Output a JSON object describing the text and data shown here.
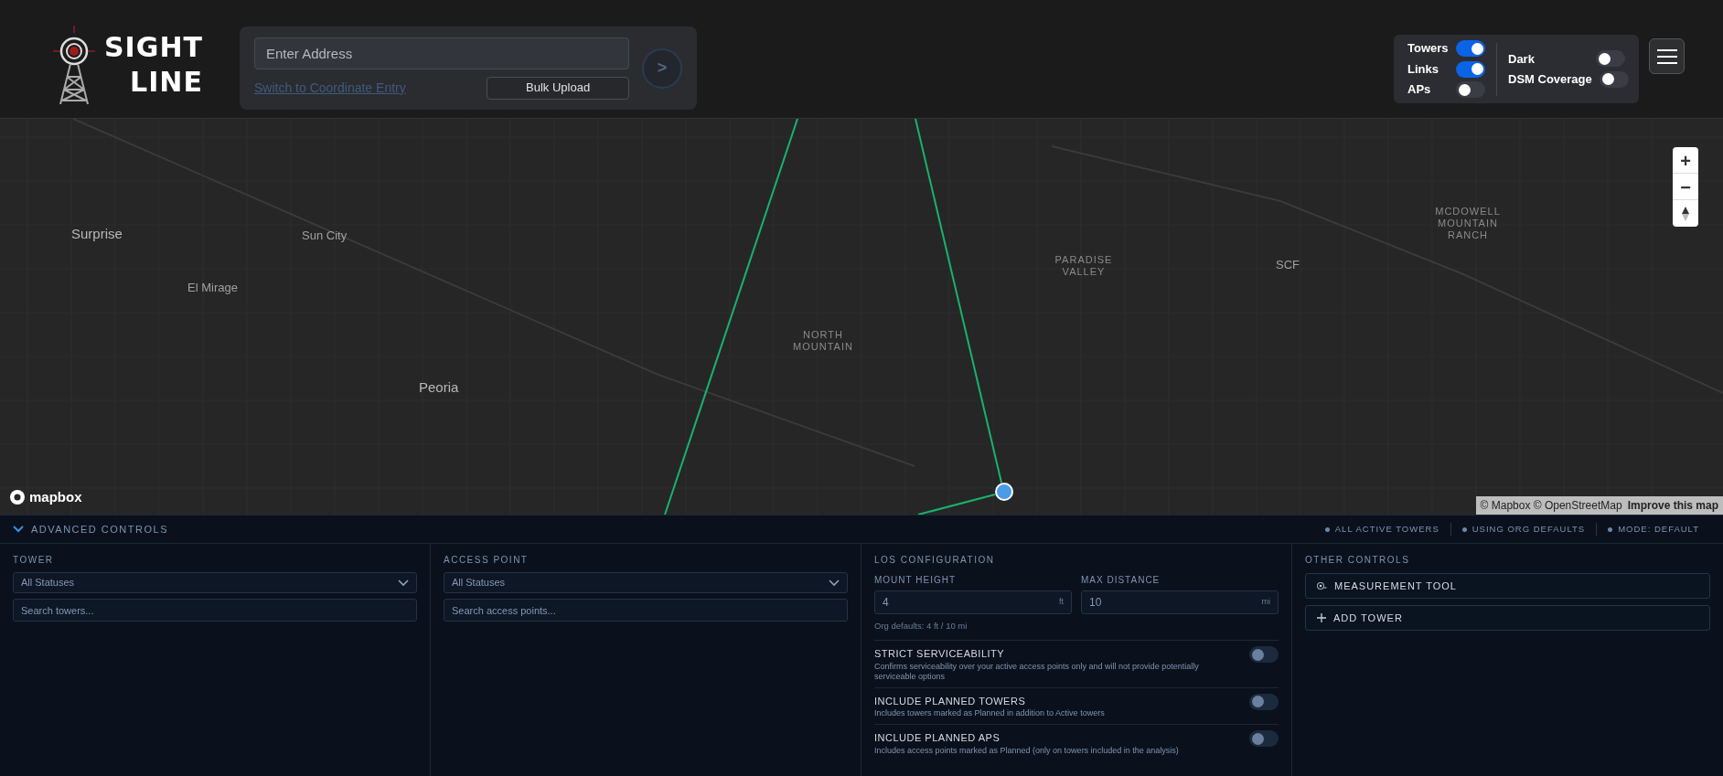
{
  "logo": {
    "line1": "SIGHT",
    "line2": "LINE"
  },
  "search": {
    "placeholder": "Enter Address",
    "link": "Switch to Coordinate Entry",
    "bulk_button": "Bulk Upload",
    "go_button": ">"
  },
  "layers_left": [
    {
      "label": "Towers",
      "on": true
    },
    {
      "label": "Links",
      "on": true
    },
    {
      "label": "APs",
      "on": false
    }
  ],
  "layers_right": [
    {
      "label": "Dark",
      "on": false
    },
    {
      "label": "DSM Coverage",
      "on": false
    }
  ],
  "map": {
    "labels": [
      {
        "text": "Surprise",
        "kind": "city"
      },
      {
        "text": "Sun City",
        "kind": "town"
      },
      {
        "text": "El Mirage",
        "kind": "town"
      },
      {
        "text": "Peoria",
        "kind": "city"
      },
      {
        "text": "NORTH MOUNTAIN",
        "kind": "area"
      },
      {
        "text": "PARADISE VALLEY",
        "kind": "area"
      },
      {
        "text": "SCF",
        "kind": "town"
      },
      {
        "text": "MCDOWELL MOUNTAIN RANCH",
        "kind": "area"
      }
    ],
    "zoom_in": "+",
    "zoom_out": "−",
    "logo_text": "mapbox",
    "attribution": "© Mapbox © OpenStreetMap",
    "improve_link": "Improve this map"
  },
  "advanced": {
    "title": "ADVANCED CONTROLS",
    "expanded": true,
    "status": [
      "ALL ACTIVE TOWERS",
      "USING ORG DEFAULTS",
      "MODE: DEFAULT"
    ]
  },
  "tower": {
    "heading": "TOWER",
    "select": "All Statuses",
    "search_placeholder": "Search towers..."
  },
  "access_point": {
    "heading": "ACCESS POINT",
    "select": "All Statuses",
    "search_placeholder": "Search access points..."
  },
  "los": {
    "heading": "LOS CONFIGURATION",
    "fields": [
      {
        "label": "MOUNT HEIGHT",
        "value": "4",
        "unit": "ft"
      },
      {
        "label": "MAX DISTANCE",
        "value": "10",
        "unit": "mi"
      }
    ],
    "defaults_note": "Org defaults: 4 ft / 10 mi",
    "options": [
      {
        "title": "STRICT SERVICEABILITY",
        "description": "Confirms serviceability over your active access points only and will not provide potentially serviceable options",
        "on": false
      },
      {
        "title": "INCLUDE PLANNED TOWERS",
        "description": "Includes towers marked as Planned in addition to Active towers",
        "on": false
      },
      {
        "title": "INCLUDE PLANNED APS",
        "description": "Includes access points marked as Planned (only on towers included in the analysis)",
        "on": false
      }
    ]
  },
  "other": {
    "heading": "OTHER CONTROLS",
    "buttons": [
      {
        "label": "MEASUREMENT TOOL",
        "kind": "measure"
      },
      {
        "label": "ADD TOWER",
        "kind": "add"
      }
    ]
  }
}
